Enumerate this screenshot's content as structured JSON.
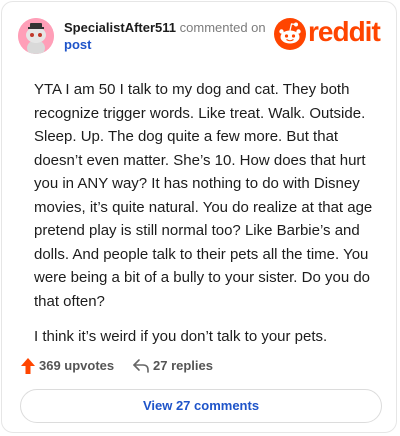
{
  "header": {
    "author": "SpecialistAfter511",
    "action": "commented on",
    "target": "post",
    "brand": "reddit"
  },
  "comment": {
    "paragraphs": [
      "YTA I am 50 I talk to my dog and cat. They both recognize trigger words. Like treat. Walk. Outside. Sleep. Up. The dog quite a few more. But that doesn’t even matter. She’s 10. How does that hurt you in ANY way? It has nothing to do with Disney movies, it’s quite natural. You do realize at that age pretend play is still normal too? Like Barbie’s and dolls. And people talk to their pets all the time. You were being a bit of a bully to your sister. Do you do that often?",
      "I think it’s weird if you don’t talk to your pets."
    ]
  },
  "actions": {
    "upvotes": "369 upvotes",
    "replies": "27 replies",
    "view_comments": "View 27 comments"
  },
  "icons": {
    "avatar": "snoo-avatar-icon",
    "logo": "reddit-logo-icon",
    "upvote": "upvote-arrow-icon",
    "reply": "reply-arrow-icon"
  },
  "colors": {
    "brand": "#ff4500",
    "link": "#1e54c9",
    "avatar_bg": "#ff9fb8"
  }
}
